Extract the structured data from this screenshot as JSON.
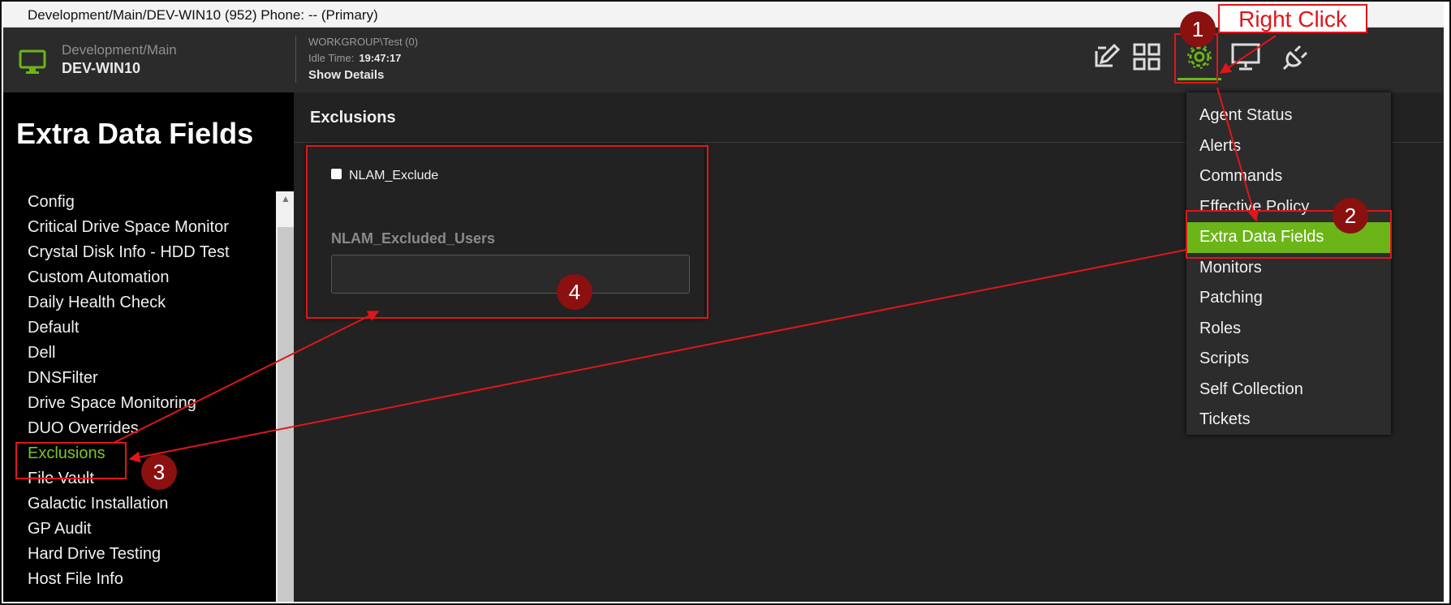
{
  "window": {
    "title": "Development/Main/DEV-WIN10 (952) Phone: -- (Primary)"
  },
  "header": {
    "path": "Development/Main",
    "device_name": "DEV-WIN10",
    "workgroup": "WORKGROUP\\Test (0)",
    "idle_label": "Idle Time:",
    "idle_value": "19:47:17",
    "show_details": "Show Details",
    "icons": [
      "edit-icon",
      "grid-icon",
      "gear-icon",
      "monitor-icon",
      "plug-icon"
    ]
  },
  "sidebar": {
    "title": "Extra Data Fields",
    "items": [
      "Config",
      "Critical Drive Space Monitor",
      "Crystal Disk Info - HDD Test",
      "Custom Automation",
      "Daily Health Check",
      "Default",
      "Dell",
      "DNSFilter",
      "Drive Space Monitoring",
      "DUO Overrides",
      "Exclusions",
      "File Vault",
      "Galactic Installation",
      "GP Audit",
      "Hard Drive Testing",
      "Host File Info"
    ],
    "active_item": "Exclusions"
  },
  "main": {
    "section_title": "Exclusions",
    "checkbox_label": "NLAM_Exclude",
    "checkbox_checked": false,
    "users_label": "NLAM_Excluded_Users",
    "users_value": ""
  },
  "context_menu": {
    "items": [
      "Agent Status",
      "Alerts",
      "Commands",
      "Effective Policy",
      "Extra Data Fields",
      "Monitors",
      "Patching",
      "Roles",
      "Scripts",
      "Self Collection",
      "Tickets"
    ],
    "highlighted": "Extra Data Fields"
  },
  "annotations": {
    "right_click_text": "Right Click",
    "step1": "1",
    "step2": "2",
    "step3": "3",
    "step4": "4"
  },
  "colors": {
    "accent_green": "#6cb518",
    "annotation_red": "#e0161b",
    "marker_dark_red": "#8b1010"
  }
}
